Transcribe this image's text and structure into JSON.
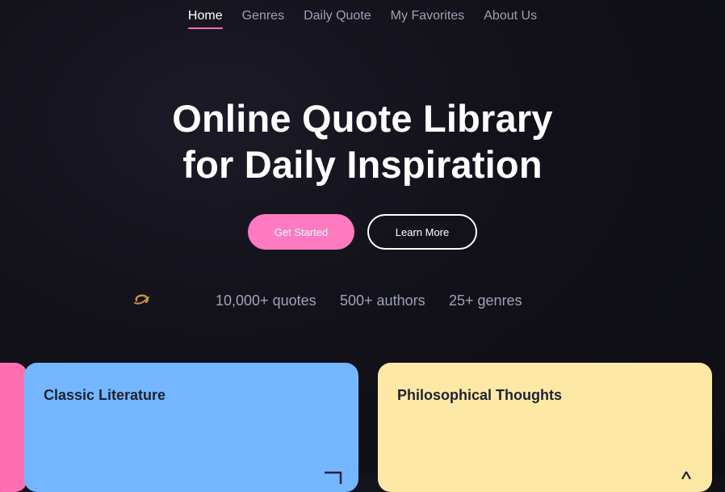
{
  "nav": {
    "items": [
      {
        "label": "Home",
        "active": true
      },
      {
        "label": "Genres",
        "active": false
      },
      {
        "label": "Daily Quote",
        "active": false
      },
      {
        "label": "My Favorites",
        "active": false
      },
      {
        "label": "About Us",
        "active": false
      }
    ]
  },
  "hero": {
    "title_line1": "Online Quote Library",
    "title_line2": "for Daily Inspiration",
    "primary_button": "Get Started",
    "secondary_button": "Learn More"
  },
  "stats": {
    "icon": "spinner-icon",
    "quotes": "10,000+ quotes",
    "authors": "500+ authors",
    "genres": "25+ genres"
  },
  "cards": [
    {
      "title": "Classic Literature",
      "color": "#74b6ff",
      "icon": "book-icon"
    },
    {
      "title": "Philosophical Thoughts",
      "color": "#fde8a6",
      "icon": "lamp-icon"
    }
  ],
  "colors": {
    "accent": "#ff7ac1",
    "background": "#121119",
    "nav_text": "#9ba1b5",
    "stat_text": "#9ea3b6"
  }
}
